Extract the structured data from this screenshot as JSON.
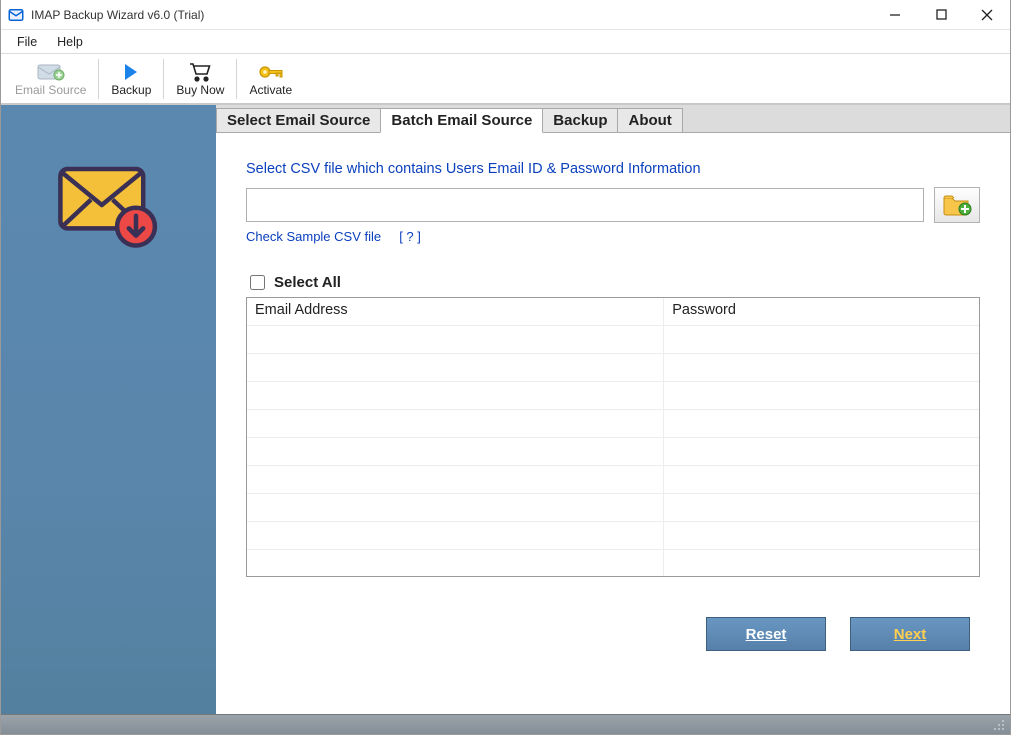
{
  "titlebar": {
    "text": "IMAP Backup Wizard v6.0 (Trial)"
  },
  "menu": {
    "file": "File",
    "help": "Help"
  },
  "toolbar": {
    "emailSource": "Email Source",
    "backup": "Backup",
    "buyNow": "Buy Now",
    "activate": "Activate"
  },
  "tabs": {
    "selectEmailSource": "Select Email Source",
    "batchEmailSource": "Batch Email Source",
    "backup": "Backup",
    "about": "About"
  },
  "batch": {
    "instruction": "Select CSV file which contains Users Email ID & Password Information",
    "csvPath": "",
    "checkSample": "Check Sample CSV file",
    "helpMark": "[ ? ]",
    "selectAll": "Select All",
    "cols": {
      "email": "Email Address",
      "password": "Password"
    },
    "reset": "Reset",
    "next": "Next"
  }
}
